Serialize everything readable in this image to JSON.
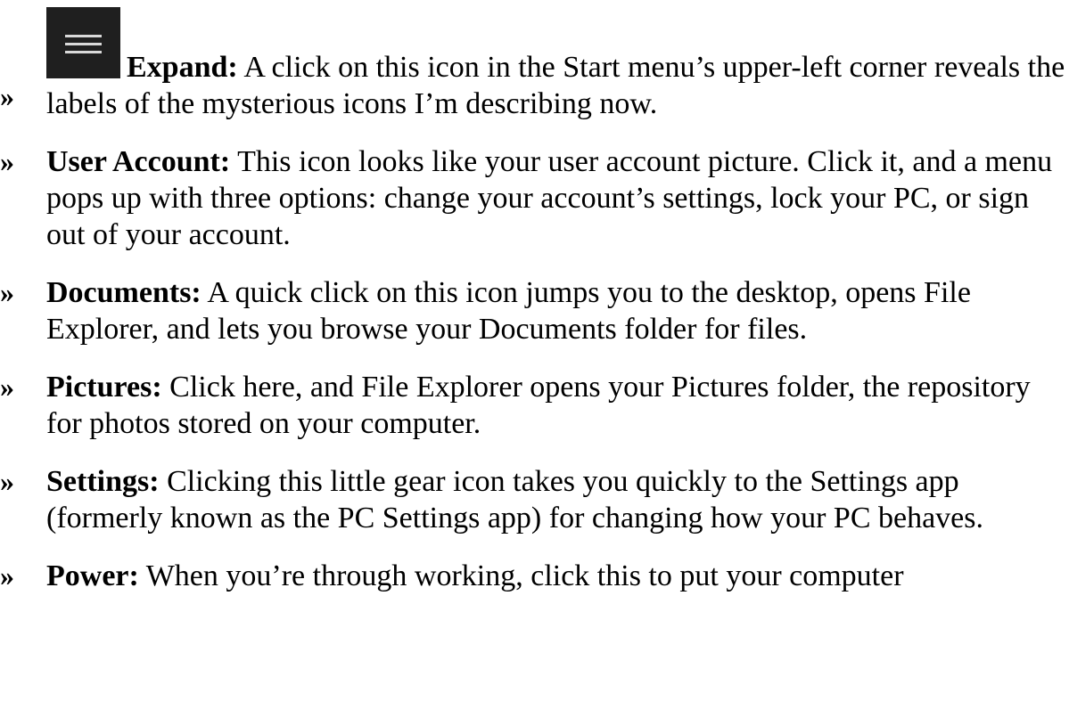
{
  "bullet_glyph": "»",
  "items": [
    {
      "icon": "hamburger-menu-icon",
      "term": "Expand:",
      "text": " A click on this icon in the Start menu’s upper-left corner reveals the labels of the mysterious icons I’m describing now."
    },
    {
      "term": "User Account:",
      "text": " This icon looks like your user account picture. Click it, and a menu pops up with three options: change your account’s settings, lock your PC, or sign out of your account."
    },
    {
      "term": "Documents:",
      "text": " A quick click on this icon jumps you to the desktop, opens File Explorer, and lets you browse your Documents folder for files."
    },
    {
      "term": "Pictures:",
      "text": " Click here, and File Explorer opens your Pictures folder, the repository for photos stored on your computer."
    },
    {
      "term": "Settings:",
      "text": " Clicking this little gear icon takes you quickly to the Settings app (formerly known as the PC Settings app) for changing how your PC behaves."
    },
    {
      "term": "Power:",
      "text": " When you’re through working, click this to put your computer"
    }
  ]
}
